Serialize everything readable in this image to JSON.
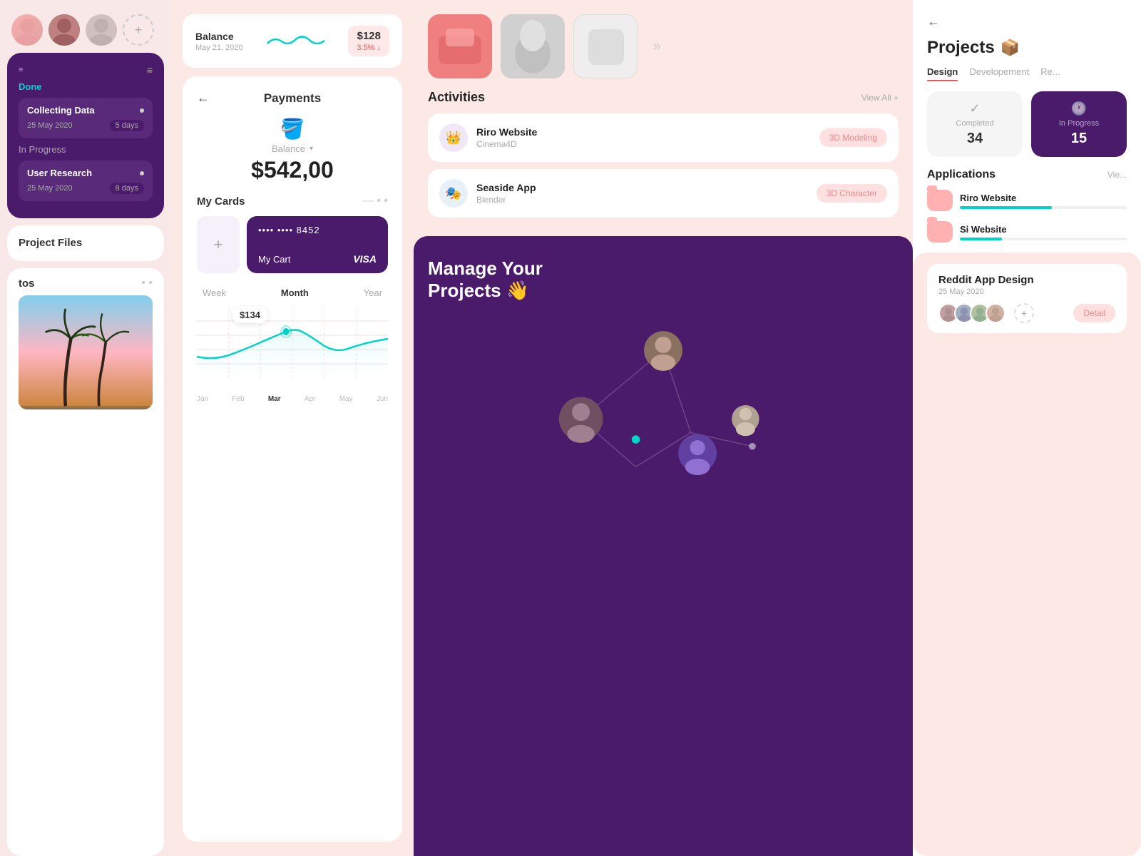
{
  "left": {
    "avatars": [
      "avatar1",
      "avatar2",
      "avatar3"
    ],
    "add_avatar_label": "+",
    "menu_dots": "≡",
    "done_label": "Done",
    "tasks": [
      {
        "name": "Collecting Data",
        "date": "25 May 2020",
        "days": "5 days"
      }
    ],
    "in_progress_label": "In Progress",
    "in_progress_tasks": [
      {
        "name": "User Research",
        "date": "25 May 2020",
        "days": "8 days"
      }
    ],
    "project_files_title": "Project Files",
    "photos_title": "tos",
    "photos_dots": "• •"
  },
  "payments": {
    "balance_label": "Balance",
    "balance_date": "May 21, 2020",
    "balance_amount": "$128",
    "balance_change": "3.5% ↓",
    "back_arrow": "←",
    "title": "Payments",
    "bucket_emoji": "🪣",
    "balance_sub": "Balance",
    "dropdown_arrow": "▾",
    "big_amount": "$542,00",
    "my_cards": "My Cards",
    "cards_dots": "— • •",
    "add_card": "+",
    "card_number": "•••• •••• 8452",
    "card_name": "My Cart",
    "visa": "VISA",
    "chart_tabs": [
      "Week",
      "Month",
      "Year"
    ],
    "active_tab": "Month",
    "chart_value": "$134",
    "chart_labels": [
      "Jan",
      "Feb",
      "Mar",
      "Apr",
      "May",
      "Jun"
    ],
    "active_label": "Mar"
  },
  "activities": {
    "title": "Activities",
    "view_all": "View All +",
    "items": [
      {
        "name": "Riro Website",
        "sub": "Cinema4D",
        "tag": "3D Modeling",
        "icon": "👑"
      },
      {
        "name": "Seaside App",
        "sub": "Blender",
        "tag": "3D Character",
        "icon": "🎭"
      }
    ]
  },
  "manage": {
    "title": "Manage Your\nProjects 👋"
  },
  "projects": {
    "back": "←",
    "title": "Projects",
    "emoji": "📦",
    "tabs": [
      "Design",
      "Developement",
      "Re..."
    ],
    "active_tab": "Design",
    "tab_dot_color": "#e55",
    "completed_label": "Completed",
    "completed_count": "34",
    "in_progress_label": "In Progress",
    "in_progress_count": "15",
    "applications_title": "Applications",
    "applications_view": "Vie...",
    "apps": [
      {
        "name": "Riro Website",
        "progress": 55
      },
      {
        "name": "Si Website",
        "progress": 25
      }
    ],
    "reddit": {
      "title": "Reddit App Design",
      "date": "25 May 2020",
      "detail_btn": "Detail"
    }
  }
}
